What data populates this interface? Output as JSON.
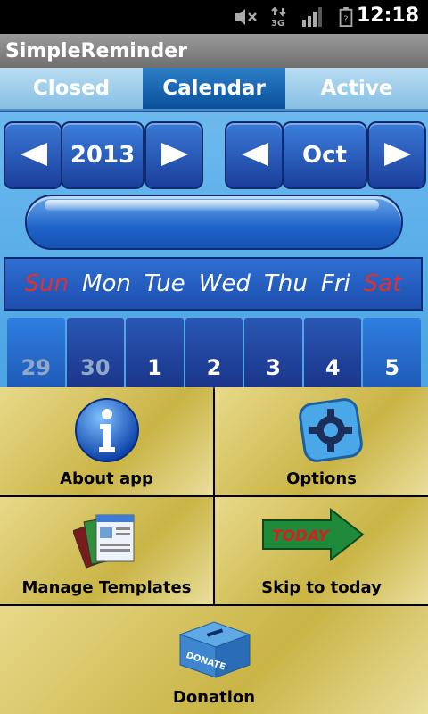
{
  "status_bar": {
    "time": "12:18",
    "icons": [
      "mute-icon",
      "data-3g-icon",
      "signal-icon",
      "battery-icon"
    ]
  },
  "app": {
    "title": "SimpleReminder"
  },
  "tabs": [
    {
      "label": "Closed",
      "active": false
    },
    {
      "label": "Calendar",
      "active": true
    },
    {
      "label": "Active",
      "active": false
    }
  ],
  "calendar": {
    "year": "2013",
    "month": "Oct",
    "weekdays": [
      "Sun",
      "Mon",
      "Tue",
      "Wed",
      "Thu",
      "Fri",
      "Sat"
    ],
    "days": [
      "29",
      "30",
      "1",
      "2",
      "3",
      "4",
      "5"
    ]
  },
  "menu": {
    "about": "About app",
    "options": "Options",
    "templates": "Manage Templates",
    "today": "Skip to today",
    "today_sign": "TODAY",
    "donation": "Donation",
    "donate_box": "DONATE"
  },
  "colors": {
    "tab_active": "#0a4f9a",
    "weekend_red": "#e03030",
    "menu_gold": "#c9b445"
  }
}
